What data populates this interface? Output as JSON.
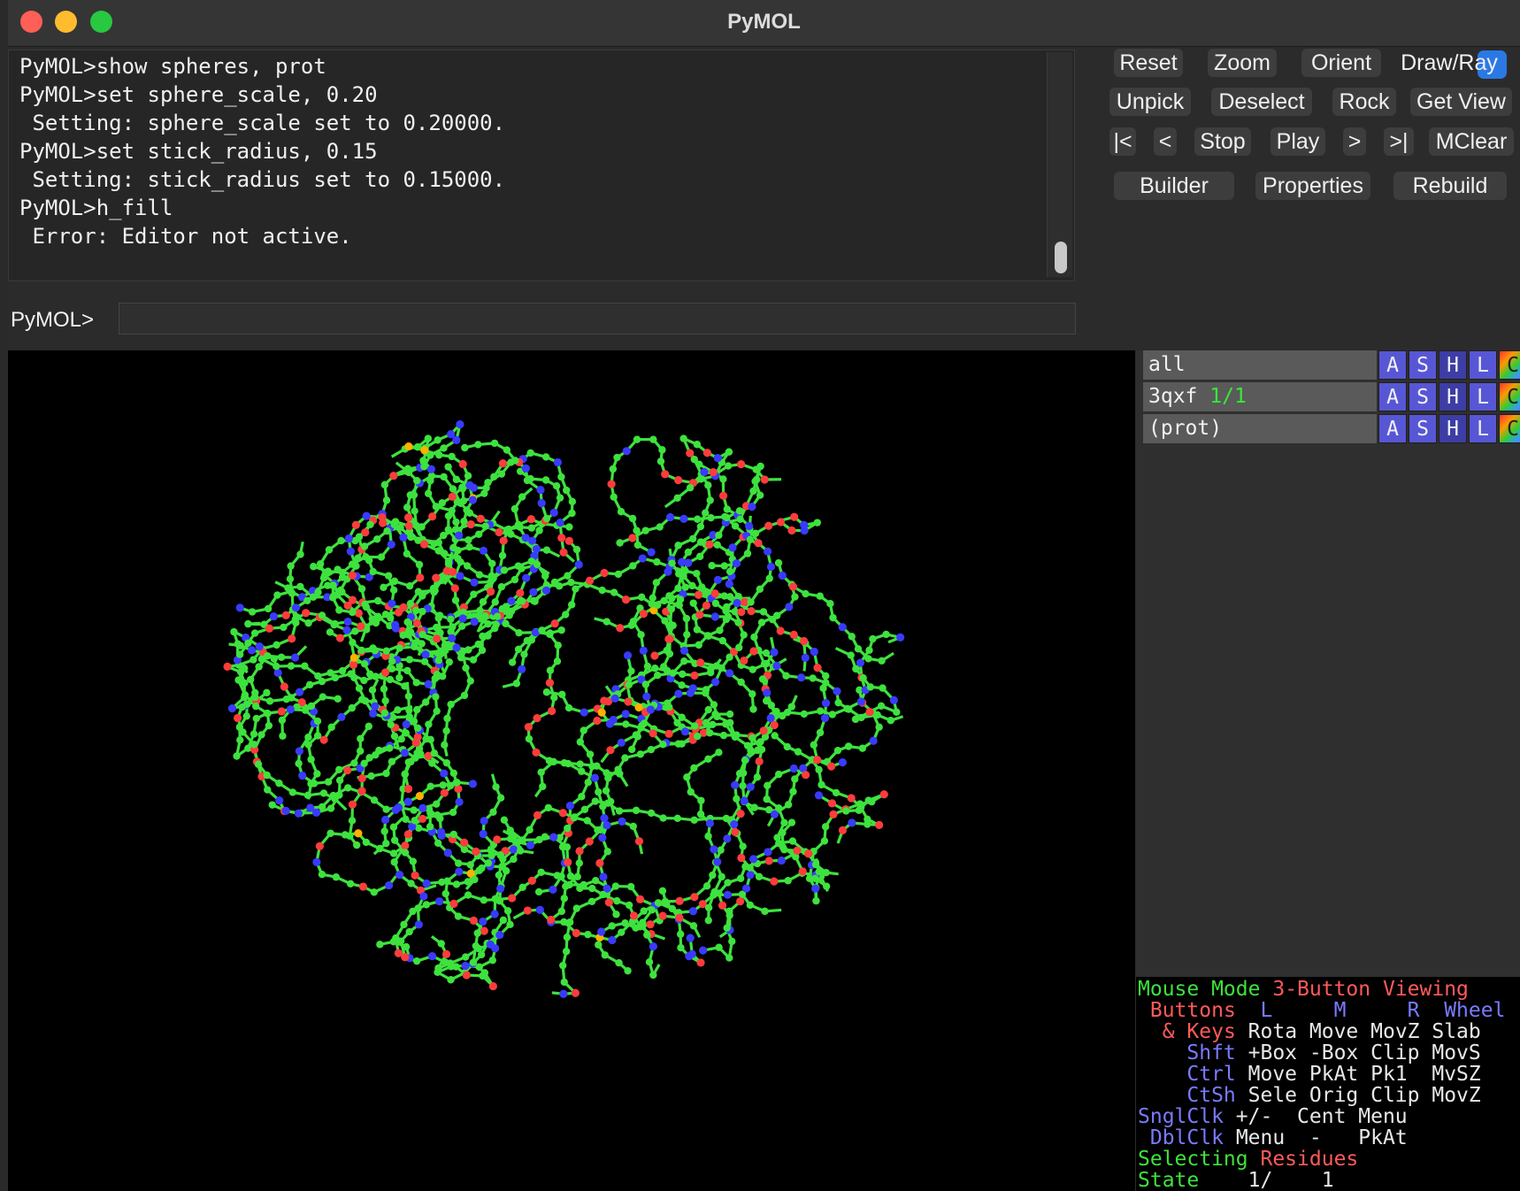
{
  "window": {
    "title": "PyMOL"
  },
  "console": {
    "lines": [
      "PyMOL>show spheres, prot",
      "PyMOL>set sphere_scale, 0.20",
      " Setting: sphere_scale set to 0.20000.",
      "PyMOL>set stick_radius, 0.15",
      " Setting: stick_radius set to 0.15000.",
      "PyMOL>h_fill",
      " Error: Editor not active."
    ]
  },
  "command": {
    "prompt": "PyMOL>",
    "value": ""
  },
  "toolbar": {
    "row1": [
      "Reset",
      "Zoom",
      "Orient",
      "Draw/Ray"
    ],
    "row2": [
      "Unpick",
      "Deselect",
      "Rock",
      "Get View"
    ],
    "row3": [
      "|<",
      "<",
      "Stop",
      "Play",
      ">",
      ">|",
      "MClear"
    ],
    "row4": [
      "Builder",
      "Properties",
      "Rebuild"
    ]
  },
  "objects": [
    {
      "name": "all",
      "state": ""
    },
    {
      "name": "3qxf",
      "state": "1/1"
    },
    {
      "name": "(prot)",
      "state": ""
    }
  ],
  "object_buttons": [
    "A",
    "S",
    "H",
    "L",
    "C"
  ],
  "mouse_mode": {
    "l1a": "Mouse Mode",
    "l1b": "3-Button Viewing",
    "l2a": "Buttons",
    "l2b": "L     M     R  Wheel",
    "l3a": "& Keys",
    "l3b": "Rota Move MovZ Slab",
    "l4a": "Shft",
    "l4b": "+Box -Box Clip MovS",
    "l5a": "Ctrl",
    "l5b": "Move PkAt Pk1  MvSZ",
    "l6a": "CtSh",
    "l6b": "Sele Orig Clip MovZ",
    "l7a": "SnglClk",
    "l7b": "+/-  Cent Menu",
    "l8a": "DblClk",
    "l8b": "Menu  -   PkAt",
    "l9a": "Selecting",
    "l9b": "Residues",
    "l10a": "State",
    "l10b": "1/    1"
  },
  "colors": {
    "carbon": "#3ee23e",
    "oxygen": "#ff3c3c",
    "nitrogen": "#3a3aff",
    "sulfur": "#ffb000",
    "viewer_bg": "#000000",
    "accent_blue": "#2b78e4"
  }
}
